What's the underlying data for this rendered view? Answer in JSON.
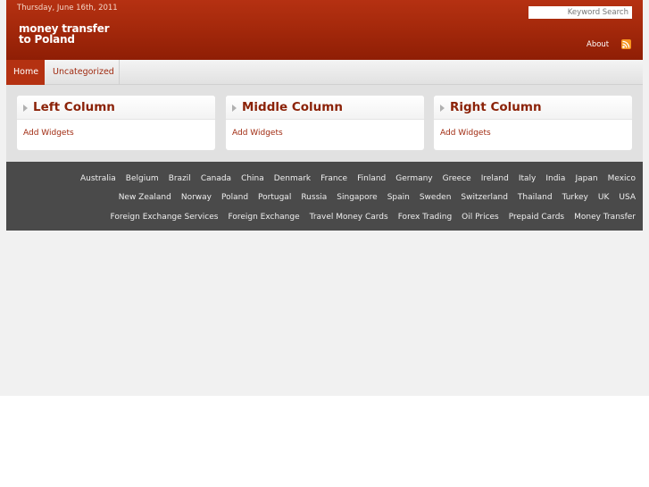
{
  "header": {
    "date": "Thursday, June 16th, 2011",
    "logo_line1": "money transfer",
    "logo_line2": "to Poland",
    "search_placeholder": "Keyword Search",
    "about_label": "About"
  },
  "nav": {
    "tabs": [
      {
        "label": "Home"
      },
      {
        "label": "Uncategorized"
      }
    ]
  },
  "widgets": [
    {
      "title": "Left Column",
      "link": "Add Widgets"
    },
    {
      "title": "Middle Column",
      "link": "Add Widgets"
    },
    {
      "title": "Right Column",
      "link": "Add Widgets"
    }
  ],
  "footer": {
    "row1": [
      "Australia",
      "Belgium",
      "Brazil",
      "Canada",
      "China",
      "Denmark",
      "France",
      "Finland",
      "Germany",
      "Greece",
      "Ireland",
      "Italy",
      "India",
      "Japan",
      "Mexico"
    ],
    "row2": [
      "New Zealand",
      "Norway",
      "Poland",
      "Portugal",
      "Russia",
      "Singapore",
      "Spain",
      "Sweden",
      "Switzerland",
      "Thailand",
      "Turkey",
      "UK",
      "USA"
    ],
    "row3": [
      "Foreign Exchange Services",
      "Foreign Exchange",
      "Travel Money Cards",
      "Forex Trading",
      "Oil Prices",
      "Prepaid Cards",
      "Money Transfer"
    ]
  },
  "colors": {
    "header_red": "#a72a0c",
    "accent_link": "#a02a10",
    "widget_title": "#8b2208",
    "footer_bg": "#4a4a4a",
    "rss_orange": "#f7931e"
  },
  "icons": {
    "rss": "rss-icon",
    "widget_arrow": "triangle-right-icon"
  }
}
